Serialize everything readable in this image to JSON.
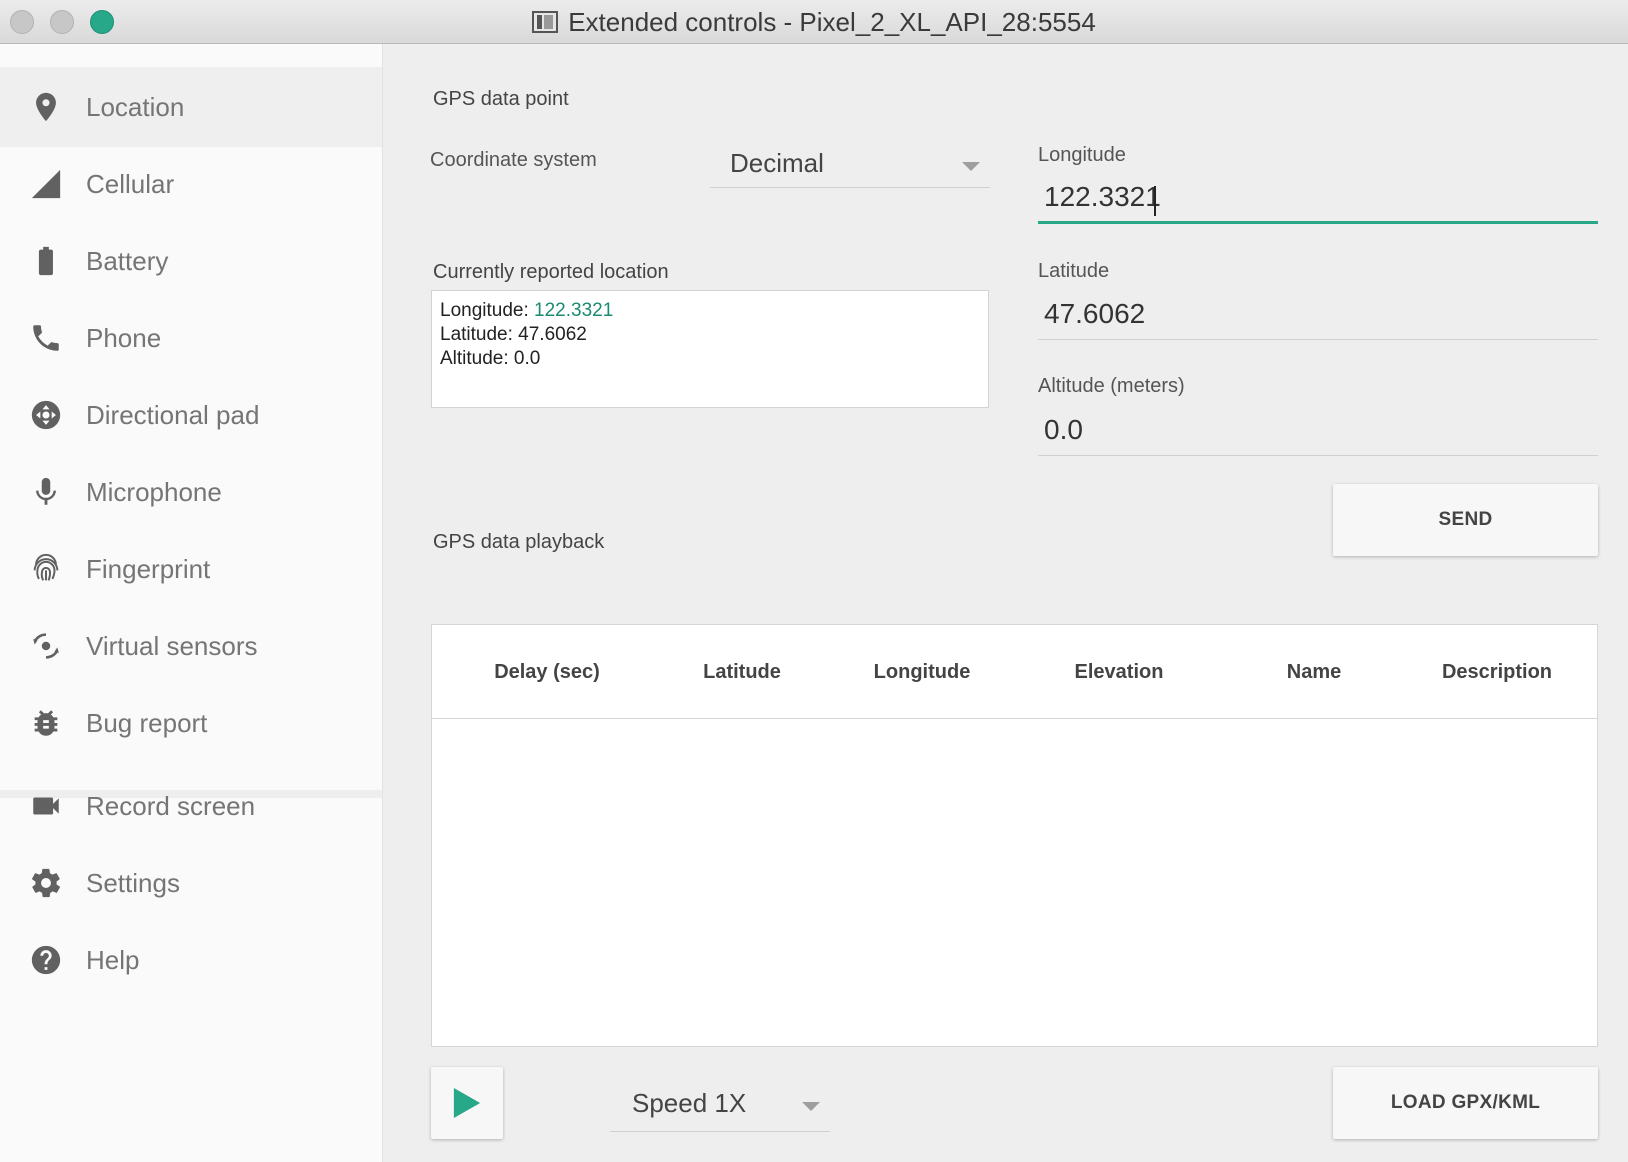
{
  "window": {
    "title": "Extended controls - Pixel_2_XL_API_28:5554"
  },
  "colors": {
    "accent": "#26a889",
    "sidebar_bg": "#fafafa",
    "main_bg": "#eeeeee"
  },
  "sidebar": {
    "items": [
      {
        "label": "Location",
        "icon": "location-pin-icon",
        "active": true
      },
      {
        "label": "Cellular",
        "icon": "cellular-signal-icon"
      },
      {
        "label": "Battery",
        "icon": "battery-icon"
      },
      {
        "label": "Phone",
        "icon": "phone-icon"
      },
      {
        "label": "Directional pad",
        "icon": "dpad-icon"
      },
      {
        "label": "Microphone",
        "icon": "microphone-icon"
      },
      {
        "label": "Fingerprint",
        "icon": "fingerprint-icon"
      },
      {
        "label": "Virtual sensors",
        "icon": "virtual-sensors-icon"
      },
      {
        "label": "Bug report",
        "icon": "bug-icon"
      },
      {
        "label": "Record screen",
        "icon": "video-camera-icon"
      },
      {
        "label": "Settings",
        "icon": "gear-icon"
      },
      {
        "label": "Help",
        "icon": "help-icon"
      }
    ]
  },
  "gps_point": {
    "section_title": "GPS data point",
    "coordinate_system_label": "Coordinate system",
    "coordinate_system_value": "Decimal",
    "longitude_label": "Longitude",
    "longitude_value": "122.3321",
    "latitude_label": "Latitude",
    "latitude_value": "47.6062",
    "altitude_label": "Altitude (meters)",
    "altitude_value": "0.0",
    "send_button": "SEND"
  },
  "reported": {
    "title": "Currently reported location",
    "longitude_label": "Longitude: ",
    "longitude_value": "122.3321",
    "latitude_line": "Latitude: 47.6062",
    "altitude_line": "Altitude: 0.0"
  },
  "playback": {
    "section_title": "GPS data playback",
    "columns": [
      "Delay (sec)",
      "Latitude",
      "Longitude",
      "Elevation",
      "Name",
      "Description"
    ],
    "speed_value": "Speed 1X",
    "load_button": "LOAD GPX/KML"
  }
}
